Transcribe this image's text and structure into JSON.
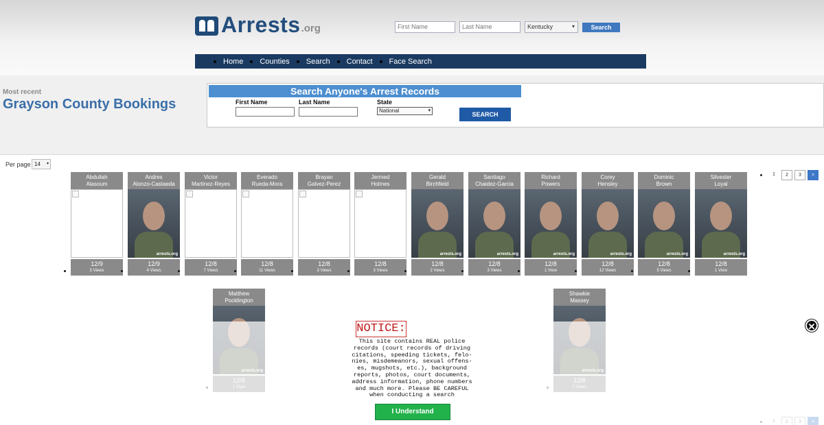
{
  "header": {
    "logo_name": "Arrests",
    "logo_tld": ".org",
    "first_name_placeholder": "First Name",
    "last_name_placeholder": "Last Name",
    "state_selected": "Kentucky",
    "search_label": "Search"
  },
  "nav": {
    "items": [
      "Home",
      "Counties",
      "Search",
      "Contact",
      "Face Search"
    ]
  },
  "page": {
    "subtitle": "Most recent",
    "title": "Grayson County Bookings"
  },
  "search_panel": {
    "heading": "Search Anyone's Arrest Records",
    "first_name_label": "First Name",
    "last_name_label": "Last Name",
    "state_label": "State",
    "state_selected": "National",
    "button_label": "SEARCH"
  },
  "listing": {
    "per_page_label": "Per page",
    "per_page_value": "14",
    "pager": [
      "1",
      "2",
      "3",
      ">"
    ],
    "bookings": [
      {
        "first": "Abdullah",
        "last": "Alasoum",
        "date": "12/9",
        "views": "3 Views",
        "photo": false
      },
      {
        "first": "Andres",
        "last": "Alonzo-Castaeda",
        "date": "12/9",
        "views": "4 Views",
        "photo": true
      },
      {
        "first": "Victor",
        "last": "Martinez-Reyes",
        "date": "12/8",
        "views": "7 Views",
        "photo": false
      },
      {
        "first": "Everado",
        "last": "Rueda-Mora",
        "date": "12/8",
        "views": "11 Views",
        "photo": false
      },
      {
        "first": "Brayan",
        "last": "Galvez-Perez",
        "date": "12/8",
        "views": "3 Views",
        "photo": false
      },
      {
        "first": "Jermed",
        "last": "Holmes",
        "date": "12/8",
        "views": "3 Views",
        "photo": false
      },
      {
        "first": "Gerald",
        "last": "Birchfield",
        "date": "12/8",
        "views": "2 Views",
        "photo": true
      },
      {
        "first": "Santiago",
        "last": "Chaidez-Garcia",
        "date": "12/8",
        "views": "3 Views",
        "photo": true
      },
      {
        "first": "Richard",
        "last": "Powers",
        "date": "12/8",
        "views": "1 View",
        "photo": true
      },
      {
        "first": "Corey",
        "last": "Hensley",
        "date": "12/8",
        "views": "12 Views",
        "photo": true
      },
      {
        "first": "Dominic",
        "last": "Brown",
        "date": "12/8",
        "views": "5 Views",
        "photo": true
      },
      {
        "first": "Silvester",
        "last": "Loyal",
        "date": "12/8",
        "views": "1 View",
        "photo": true
      },
      {
        "first": "Matthew",
        "last": "Pocklington",
        "date": "12/8",
        "views": "1 View",
        "photo": true
      },
      {
        "first": "Shawkie",
        "last": "Massey",
        "date": "12/8",
        "views": "2 Views",
        "photo": true
      }
    ],
    "watermark": "arrests.org"
  },
  "notice": {
    "title": "NOTICE:",
    "text": "This site contains REAL police\nrecords (court records of driving\ncitations, speeding tickets, felo-\nnies, misdemeanors, sexual offens-\nes, mugshots, etc.), background\nreports, photos, court documents,\naddress information, phone numbers\nand much more. Please BE CAREFUL\nwhen conducting a search",
    "button_label": "I Understand",
    "close_label": "✕"
  }
}
